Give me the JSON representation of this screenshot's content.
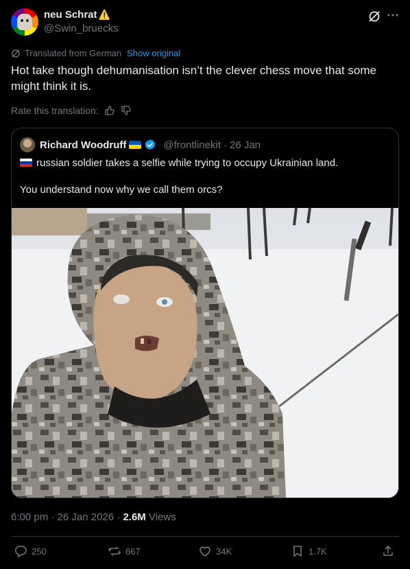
{
  "author": {
    "name": "neu Schrat",
    "name_emoji": "⚠️",
    "handle": "@Swin_bruecks"
  },
  "translation": {
    "notice": "Translated from German",
    "show_original": "Show original",
    "rate_label": "Rate this translation:"
  },
  "tweet": {
    "text": "Hot take though dehumanisation isn’t the clever chess move that some might think it is."
  },
  "quoted": {
    "name": "Richard Woodruff",
    "handle": "@frontlinekit",
    "dot": "·",
    "date": "26 Jan",
    "line1": "russian soldier takes a selfie while trying to occupy Ukrainian land.",
    "line2": "You understand now why we call them orcs?"
  },
  "meta": {
    "time": "6:00 pm · 26 Jan 2026 · ",
    "views_count": "2.6M",
    "views_label": " Views"
  },
  "actions": {
    "replies": "250",
    "reposts": "667",
    "likes": "34K",
    "bookmarks": "1.7K"
  },
  "colors": {
    "background": "#000000",
    "text": "#e7e9ea",
    "muted": "#71767b",
    "accent": "#1d9bf0",
    "border": "#2f3336"
  },
  "icons": [
    "grok-icon",
    "more-icon",
    "translate-icon",
    "thumbs-up-icon",
    "thumbs-down-icon",
    "verified-badge-icon",
    "reply-icon",
    "repost-icon",
    "like-icon",
    "bookmark-icon",
    "share-icon"
  ]
}
